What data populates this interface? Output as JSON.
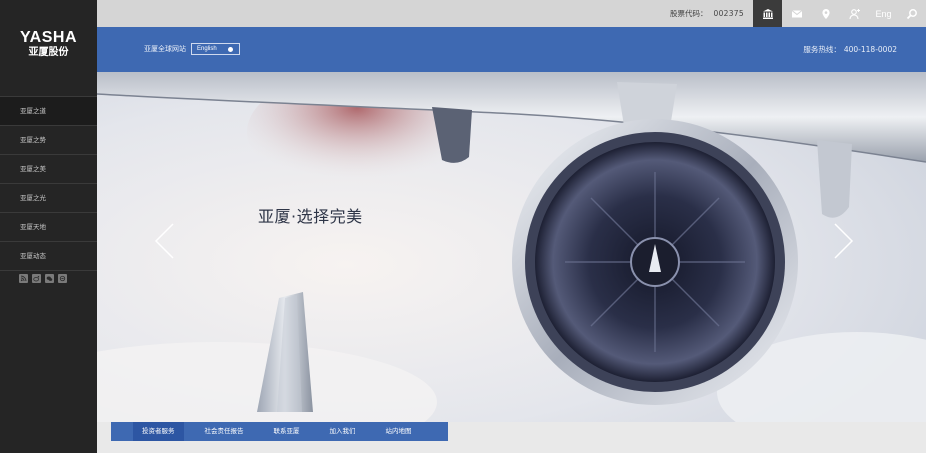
{
  "brand": {
    "logo_en": "YASHA",
    "logo_zh": "亚厦股份"
  },
  "sidebar": {
    "items": [
      {
        "label": "亚厦之道"
      },
      {
        "label": "亚厦之势"
      },
      {
        "label": "亚厦之美"
      },
      {
        "label": "亚厦之光"
      },
      {
        "label": "亚厦天地"
      },
      {
        "label": "亚厦动态"
      }
    ],
    "social_icons": [
      "rss-icon",
      "weibo-icon",
      "wechat-icon",
      "link-icon"
    ]
  },
  "topbar": {
    "stock_label": "股票代码：",
    "stock_code": "002375",
    "icons": [
      "bank-icon",
      "mail-icon",
      "location-pin-icon",
      "add-user-icon",
      "search-icon"
    ],
    "lang_label": "Eng"
  },
  "header": {
    "global_sites_label": "亚厦全球网站",
    "lang_select_value": "English",
    "hotline_label": "服务热线：",
    "hotline_number": "400-118-0002",
    "accent_color": "#3e69b2"
  },
  "banner": {
    "slogan": "亚厦·选择完美"
  },
  "bottom_tabs": [
    {
      "label": "投资者服务"
    },
    {
      "label": "社会责任报告"
    },
    {
      "label": "联系亚厦"
    },
    {
      "label": "加入我们"
    },
    {
      "label": "站内地图"
    }
  ]
}
